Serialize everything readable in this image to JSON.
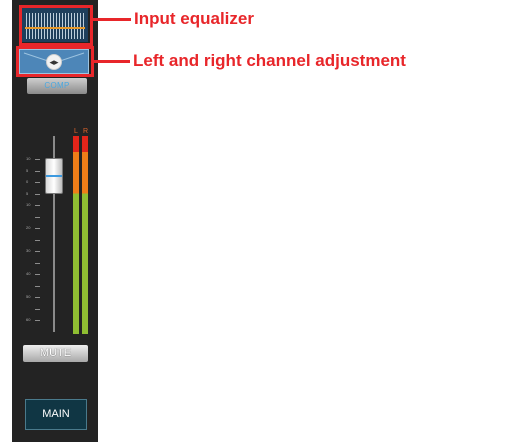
{
  "buttons": {
    "comp": "COMP",
    "mute": "MUTE",
    "main": "MAIN"
  },
  "meter_labels": {
    "left": "L",
    "right": "R"
  },
  "fader_scale": [
    "10",
    "5",
    "0",
    "5",
    "10",
    "",
    "20",
    "",
    "30",
    "",
    "40",
    "",
    "50",
    "",
    "60"
  ],
  "callouts": {
    "input_eq": "Input equalizer",
    "pan": "Left and right channel adjustment"
  },
  "colors": {
    "strip_background": "#232323",
    "callout": "#e8262a",
    "accent_blue": "#4d86b8",
    "meter_green": "#8fbe32",
    "meter_orange": "#ef7d18",
    "meter_red": "#e2251a"
  },
  "icons": {
    "pan_knob": "arrows-left-right-icon"
  }
}
